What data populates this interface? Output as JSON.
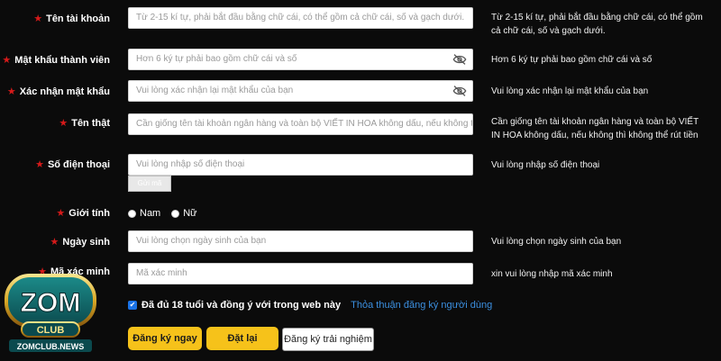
{
  "form": {
    "fields": [
      {
        "label": "Tên tài khoản",
        "placeholder": "Từ 2-15 kí tự, phải bắt đầu bằng chữ cái, có thể  gồm cả chữ cái, số và gạch dưới.",
        "hint": "Từ 2-15 kí tự, phải bắt đầu bằng chữ cái, có thể gồm cả chữ cái, số và gạch dưới.",
        "required": true
      },
      {
        "label": "Mật khẩu thành viên",
        "placeholder": "Hơn 6 ký tự phải bao gồm chữ cái và số",
        "hint": "Hơn 6 ký tự phải bao gồm chữ cái và số",
        "required": true
      },
      {
        "label": "Xác nhận mật khẩu",
        "placeholder": "Vui lòng xác nhận lại mật khẩu của bạn",
        "hint": "Vui lòng xác nhận lại mật khẩu của bạn",
        "required": true
      },
      {
        "label": "Tên thật",
        "placeholder": "Cần giống tên tài khoản ngân hàng và toàn bộ VIẾT IN HOA không dấu, nếu không thì",
        "hint": "Cần giống tên tài khoản ngân hàng và toàn bộ VIẾT IN HOA không dấu, nếu không thì không thể rút tiền",
        "required": true
      },
      {
        "label": "Số điện thoại",
        "placeholder": "Vui lòng nhập số điện thoại",
        "hint": "Vui lòng nhập số điện thoại",
        "required": true
      },
      {
        "label": "Giới tính",
        "required": true
      },
      {
        "label": "Ngày sinh",
        "placeholder": "Vui lòng chọn ngày sinh của bạn",
        "hint": "Vui lòng chọn ngày sinh của bạn",
        "required": true
      },
      {
        "label": "Mã xác minh",
        "placeholder": "Mã xác minh",
        "hint": "xin vui lòng nhập mã xác minh",
        "required": true
      }
    ],
    "gender_options": [
      "Nam",
      "Nữ"
    ],
    "captcha_button": "Gửi mã",
    "agree_text": "Đã đủ 18 tuổi và đồng ý với trong web này",
    "agree_link": "Thỏa thuận đăng ký người dùng",
    "agree_checked": true,
    "buttons": {
      "register": "Đăng ký ngay",
      "reset": "Đặt lại",
      "trial": "Đăng ký trải nghiệm"
    }
  },
  "logo": {
    "main": "ZOM",
    "sub": "CLUB",
    "domain": "ZOMCLUB.NEWS"
  },
  "colors": {
    "background": "#0b0b0b",
    "star": "#d61a1a",
    "accent_yellow": "#f6c21a",
    "link_blue": "#3b8fe0",
    "checkbox_blue": "#1a73e8"
  },
  "icons": {
    "password_toggle": "eye-off-icon",
    "required": "star-icon",
    "check": "checkmark-icon"
  }
}
